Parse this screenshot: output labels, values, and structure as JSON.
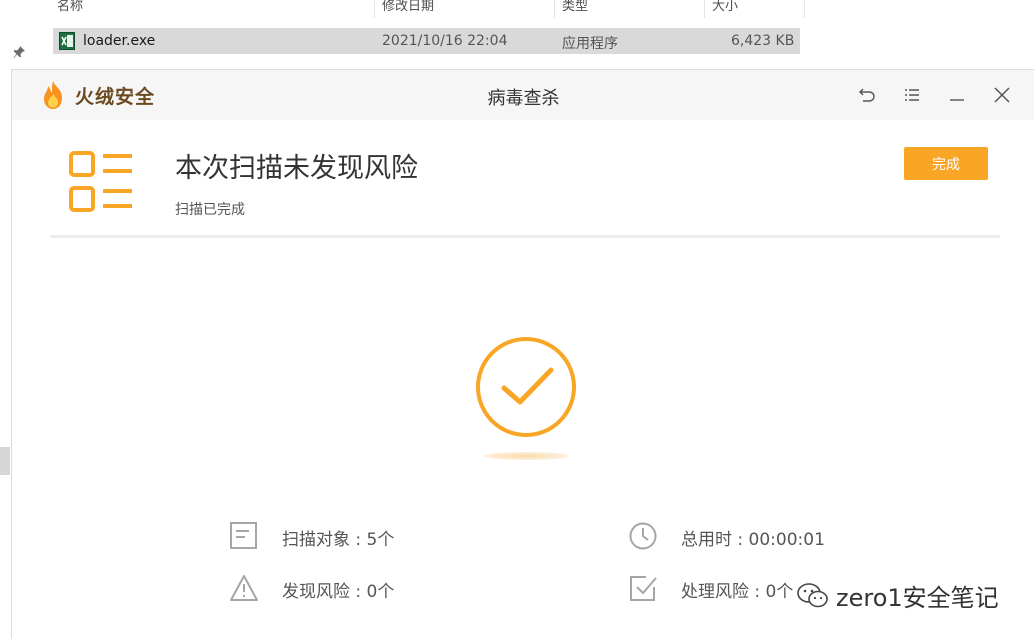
{
  "explorer": {
    "columns": [
      "名称",
      "修改日期",
      "类型",
      "大小"
    ],
    "file": {
      "name": "loader.exe",
      "modified": "2021/10/16 22:04",
      "type": "应用程序",
      "size": "6,423 KB"
    }
  },
  "dialog": {
    "brand": "火绒安全",
    "title": "病毒查杀",
    "headline": "本次扫描未发现风险",
    "subline": "扫描已完成",
    "done_label": "完成",
    "stats": {
      "scanned": "扫描对象 : 5个",
      "elapsed": "总用时 : 00:00:01",
      "found": "发现风险 : 0个",
      "handled": "处理风险 : 0个"
    }
  },
  "watermark": {
    "text": "zero1安全笔记"
  },
  "colors": {
    "accent": "#f9a525",
    "brand_text": "#6a4a21",
    "titlebar": "#f6f6f6"
  },
  "icons": {
    "titlebar": [
      "back-icon",
      "menu-icon",
      "minimize-icon",
      "close-icon"
    ],
    "stats": [
      "document-icon",
      "clock-icon",
      "warning-icon",
      "checkbox-icon"
    ]
  }
}
